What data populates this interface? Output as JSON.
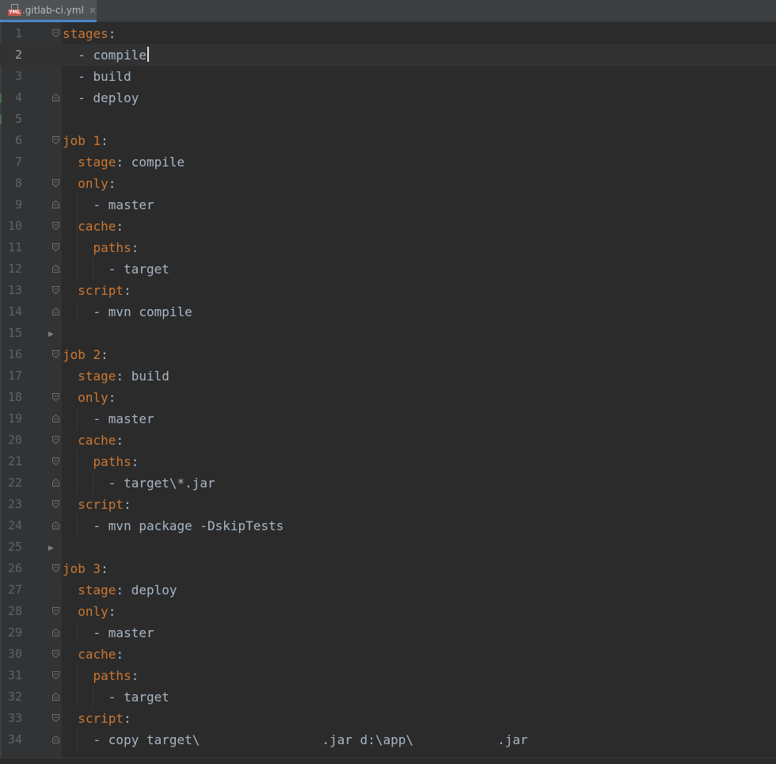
{
  "tab": {
    "label": ".gitlab-ci.yml",
    "badge": "YML",
    "close": "×"
  },
  "editor": {
    "current_line": 2,
    "lines": [
      {
        "n": "1",
        "indent": "",
        "key": "stages",
        "sep": ":",
        "dash": "",
        "value": ""
      },
      {
        "n": "2",
        "indent": "  ",
        "key": "",
        "sep": "",
        "dash": "- ",
        "value": "compile"
      },
      {
        "n": "3",
        "indent": "  ",
        "key": "",
        "sep": "",
        "dash": "- ",
        "value": "build"
      },
      {
        "n": "4",
        "indent": "  ",
        "key": "",
        "sep": "",
        "dash": "- ",
        "value": "deploy"
      },
      {
        "n": "5",
        "indent": "",
        "key": "",
        "sep": "",
        "dash": "",
        "value": ""
      },
      {
        "n": "6",
        "indent": "",
        "key": "job 1",
        "sep": ":",
        "dash": "",
        "value": ""
      },
      {
        "n": "7",
        "indent": "  ",
        "key": "stage",
        "sep": ": ",
        "dash": "",
        "value": "compile"
      },
      {
        "n": "8",
        "indent": "  ",
        "key": "only",
        "sep": ":",
        "dash": "",
        "value": ""
      },
      {
        "n": "9",
        "indent": "    ",
        "key": "",
        "sep": "",
        "dash": "- ",
        "value": "master"
      },
      {
        "n": "10",
        "indent": "  ",
        "key": "cache",
        "sep": ":",
        "dash": "",
        "value": ""
      },
      {
        "n": "11",
        "indent": "    ",
        "key": "paths",
        "sep": ":",
        "dash": "",
        "value": ""
      },
      {
        "n": "12",
        "indent": "      ",
        "key": "",
        "sep": "",
        "dash": "- ",
        "value": "target"
      },
      {
        "n": "13",
        "indent": "  ",
        "key": "script",
        "sep": ":",
        "dash": "",
        "value": ""
      },
      {
        "n": "14",
        "indent": "    ",
        "key": "",
        "sep": "",
        "dash": "- ",
        "value": "mvn compile"
      },
      {
        "n": "15",
        "indent": "",
        "key": "",
        "sep": "",
        "dash": "",
        "value": ""
      },
      {
        "n": "16",
        "indent": "",
        "key": "job 2",
        "sep": ":",
        "dash": "",
        "value": ""
      },
      {
        "n": "17",
        "indent": "  ",
        "key": "stage",
        "sep": ": ",
        "dash": "",
        "value": "build"
      },
      {
        "n": "18",
        "indent": "  ",
        "key": "only",
        "sep": ":",
        "dash": "",
        "value": ""
      },
      {
        "n": "19",
        "indent": "    ",
        "key": "",
        "sep": "",
        "dash": "- ",
        "value": "master"
      },
      {
        "n": "20",
        "indent": "  ",
        "key": "cache",
        "sep": ":",
        "dash": "",
        "value": ""
      },
      {
        "n": "21",
        "indent": "    ",
        "key": "paths",
        "sep": ":",
        "dash": "",
        "value": ""
      },
      {
        "n": "22",
        "indent": "      ",
        "key": "",
        "sep": "",
        "dash": "- ",
        "value": "target\\*.jar"
      },
      {
        "n": "23",
        "indent": "  ",
        "key": "script",
        "sep": ":",
        "dash": "",
        "value": ""
      },
      {
        "n": "24",
        "indent": "    ",
        "key": "",
        "sep": "",
        "dash": "- ",
        "value": "mvn package -DskipTests"
      },
      {
        "n": "25",
        "indent": "",
        "key": "",
        "sep": "",
        "dash": "",
        "value": ""
      },
      {
        "n": "26",
        "indent": "",
        "key": "job 3",
        "sep": ":",
        "dash": "",
        "value": ""
      },
      {
        "n": "27",
        "indent": "  ",
        "key": "stage",
        "sep": ": ",
        "dash": "",
        "value": "deploy"
      },
      {
        "n": "28",
        "indent": "  ",
        "key": "only",
        "sep": ":",
        "dash": "",
        "value": ""
      },
      {
        "n": "29",
        "indent": "    ",
        "key": "",
        "sep": "",
        "dash": "- ",
        "value": "master"
      },
      {
        "n": "30",
        "indent": "  ",
        "key": "cache",
        "sep": ":",
        "dash": "",
        "value": ""
      },
      {
        "n": "31",
        "indent": "    ",
        "key": "paths",
        "sep": ":",
        "dash": "",
        "value": ""
      },
      {
        "n": "32",
        "indent": "      ",
        "key": "",
        "sep": "",
        "dash": "- ",
        "value": "target"
      },
      {
        "n": "33",
        "indent": "  ",
        "key": "script",
        "sep": ":",
        "dash": "",
        "value": ""
      },
      {
        "n": "34",
        "indent": "    ",
        "key": "",
        "sep": "",
        "dash": "- ",
        "value": "copy target\\                .jar d:\\app\\           .jar"
      }
    ]
  },
  "colors": {
    "background": "#2b2b2b",
    "key": "#cc7832",
    "text": "#a9b7c6",
    "line_number": "#606366",
    "tab_underline": "#4a88c7"
  }
}
